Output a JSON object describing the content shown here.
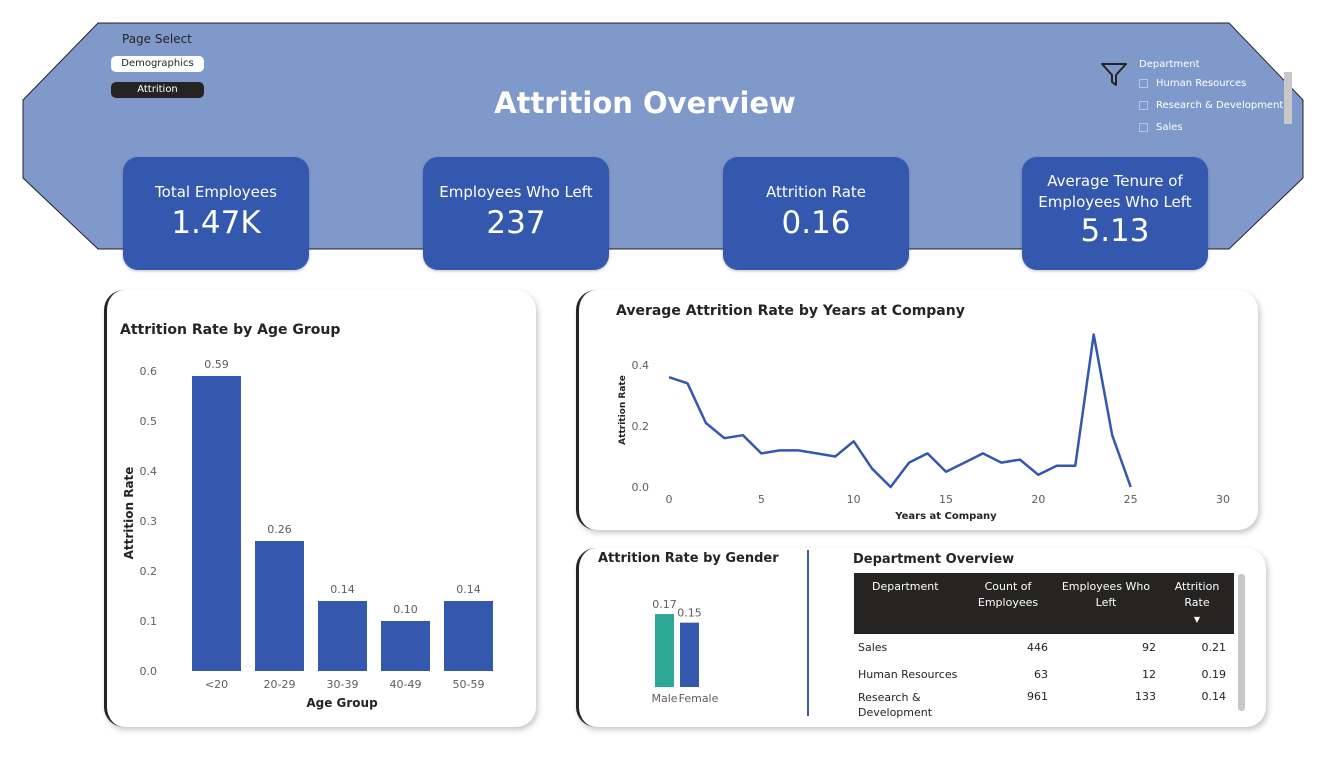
{
  "header": {
    "title": "Attrition Overview",
    "page_select_label": "Page Select",
    "nav": [
      "Demographics",
      "Attrition"
    ],
    "banner_color": "#8099cb"
  },
  "slicer": {
    "title": "Department",
    "options": [
      "Human Resources",
      "Research & Development",
      "Sales"
    ]
  },
  "kpis": [
    {
      "label": "Total Employees",
      "value": "1.47K"
    },
    {
      "label": "Employees Who Left",
      "value": "237"
    },
    {
      "label": "Attrition Rate",
      "value": "0.16"
    },
    {
      "label": "Average Tenure of Employees Who Left",
      "value": "5.13"
    }
  ],
  "chart_data": [
    {
      "type": "bar",
      "title": "Attrition Rate by Age Group",
      "categories": [
        "<20",
        "20-29",
        "30-39",
        "40-49",
        "50-59"
      ],
      "values": [
        0.59,
        0.26,
        0.14,
        0.1,
        0.14
      ],
      "data_labels": [
        "0.59",
        "0.26",
        "0.14",
        "0.10",
        "0.14"
      ],
      "xlabel": "Age Group",
      "ylabel": "Attrition Rate",
      "yticks": [
        "0.0",
        "0.1",
        "0.2",
        "0.3",
        "0.4",
        "0.5",
        "0.6"
      ],
      "ylim": [
        0,
        0.6
      ],
      "color": "#3358ad"
    },
    {
      "type": "line",
      "title": "Average Attrition Rate by Years at Company",
      "x": [
        0,
        1,
        2,
        3,
        4,
        5,
        6,
        7,
        8,
        9,
        10,
        11,
        12,
        13,
        14,
        15,
        16,
        17,
        18,
        19,
        20,
        21,
        22,
        23,
        24,
        25
      ],
      "y": [
        0.36,
        0.34,
        0.21,
        0.16,
        0.17,
        0.11,
        0.12,
        0.12,
        0.11,
        0.1,
        0.15,
        0.06,
        0.0,
        0.08,
        0.11,
        0.05,
        0.08,
        0.11,
        0.08,
        0.09,
        0.04,
        0.07,
        0.07,
        0.5,
        0.17,
        0.0
      ],
      "xlabel": "Years at Company",
      "ylabel": "Attrition Rate",
      "xticks": [
        "0",
        "5",
        "10",
        "15",
        "20",
        "25",
        "30"
      ],
      "yticks": [
        "0.0",
        "0.2",
        "0.4"
      ],
      "xlim": [
        0,
        30
      ],
      "ylim": [
        0,
        0.4
      ],
      "color": "#3358ad"
    },
    {
      "type": "bar",
      "title": "Attrition Rate by Gender",
      "categories": [
        "Male",
        "Female"
      ],
      "values": [
        0.17,
        0.15
      ],
      "data_labels": [
        "0.17",
        "0.15"
      ],
      "colors": [
        "#2ea896",
        "#3358ad"
      ]
    }
  ],
  "department_overview": {
    "title": "Department Overview",
    "columns": [
      "Department",
      "Count of Employees",
      "Employees Who Left",
      "Attrition Rate"
    ],
    "rows": [
      [
        "Sales",
        "446",
        "92",
        "0.21"
      ],
      [
        "Human Resources",
        "63",
        "12",
        "0.19"
      ],
      [
        "Research & Development",
        "961",
        "133",
        "0.14"
      ]
    ]
  }
}
